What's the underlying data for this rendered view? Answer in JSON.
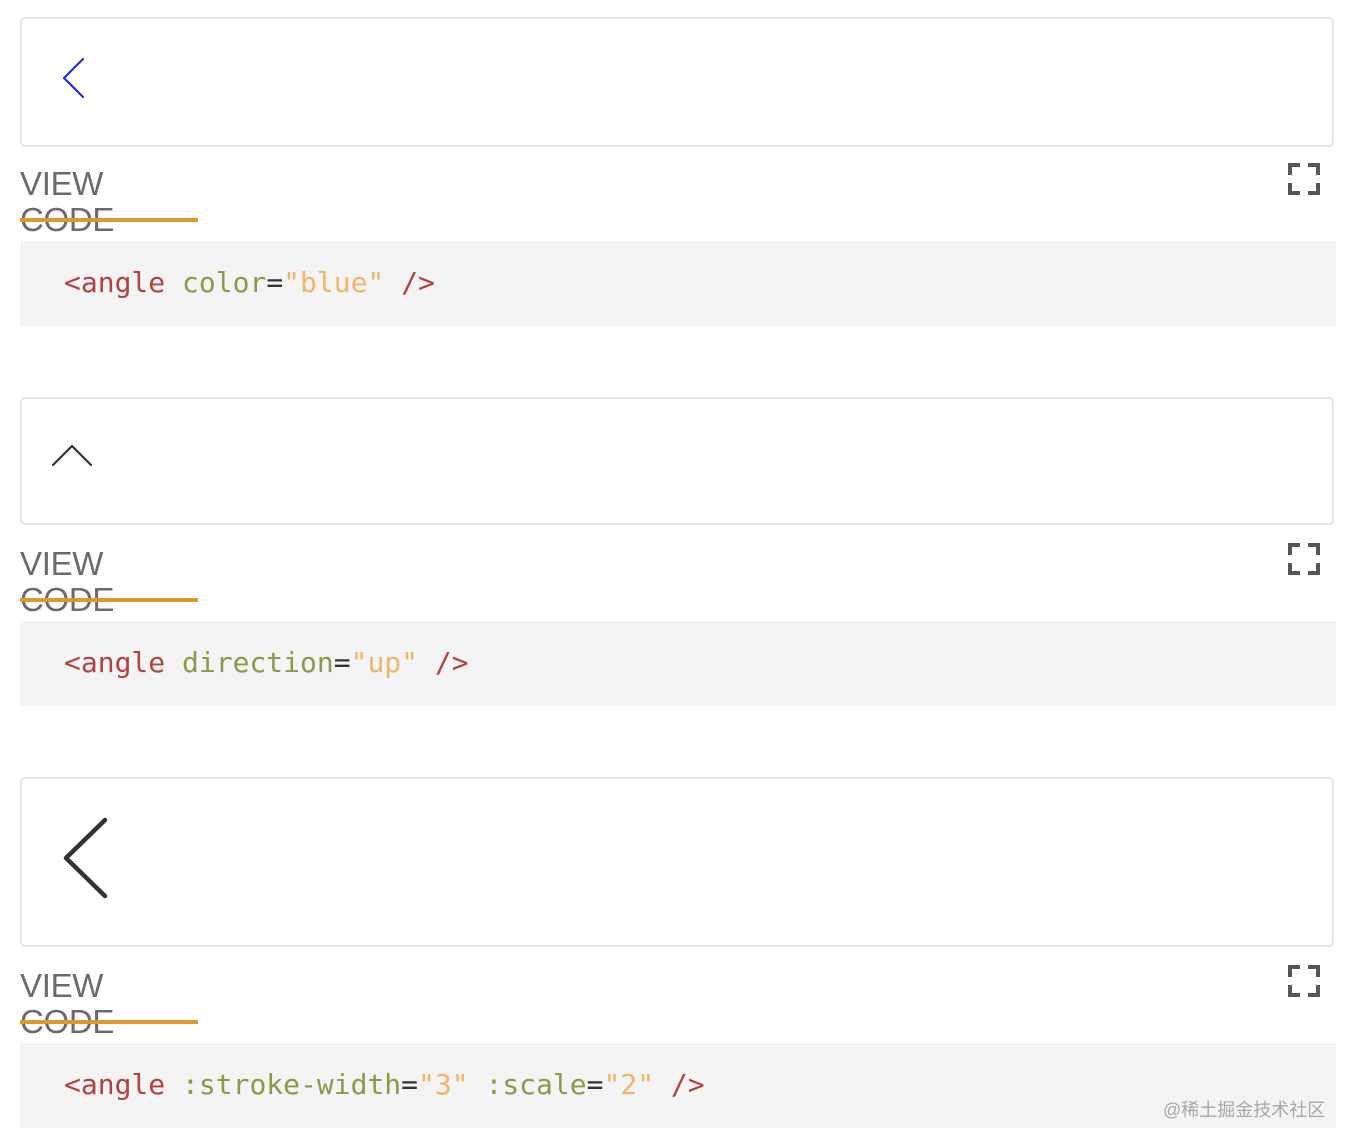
{
  "demos": [
    {
      "icon": {
        "name": "angle-left-icon",
        "color": "#1a33d6"
      },
      "view_code_label": "VIEW CODE",
      "fullscreen_icon": "fullscreen-icon",
      "code": {
        "tag_open": "<angle",
        "attrs": [
          {
            "name": "color",
            "eq": "=",
            "value": "\"blue\""
          }
        ],
        "tag_close": "/>"
      }
    },
    {
      "icon": {
        "name": "angle-up-icon",
        "color": "#333333"
      },
      "view_code_label": "VIEW CODE",
      "fullscreen_icon": "fullscreen-icon",
      "code": {
        "tag_open": "<angle",
        "attrs": [
          {
            "name": "direction",
            "eq": "=",
            "value": "\"up\""
          }
        ],
        "tag_close": "/>"
      }
    },
    {
      "icon": {
        "name": "angle-left-large-icon",
        "color": "#333333"
      },
      "view_code_label": "VIEW CODE",
      "fullscreen_icon": "fullscreen-icon",
      "code": {
        "tag_open": "<angle",
        "attrs": [
          {
            "name": ":stroke-width",
            "eq": "=",
            "value": "\"3\""
          },
          {
            "name": ":scale",
            "eq": "=",
            "value": "\"2\""
          }
        ],
        "tag_close": "/>"
      }
    }
  ],
  "colors": {
    "tab_underline": "#dd9a2c",
    "code_tag": "#b24141",
    "code_attr": "#8a9a4a",
    "code_string": "#f0b56b"
  },
  "watermark": "@稀土掘金技术社区"
}
